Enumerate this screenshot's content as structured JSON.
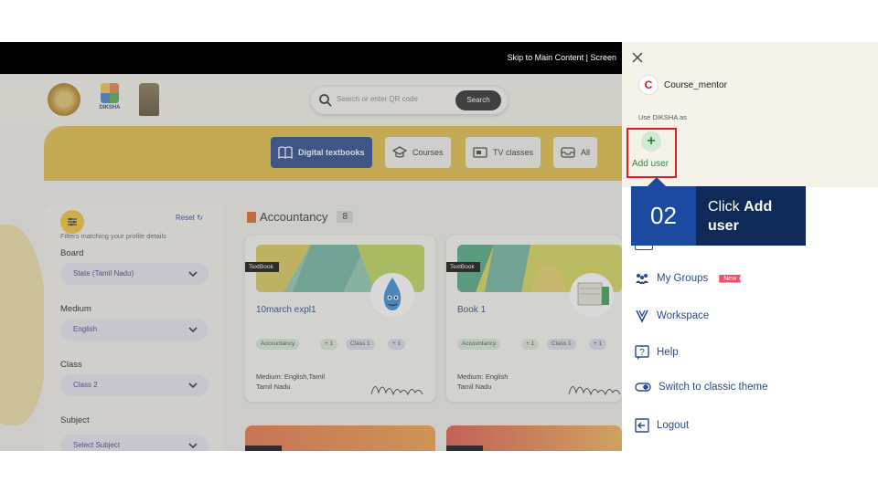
{
  "skip_bar": {
    "text": "Skip to Main Content  |  Screen"
  },
  "header": {
    "diksha_logo_text": "DIKSHA",
    "search_placeholder": "Search or enter QR code",
    "search_button": "Search"
  },
  "tabs": [
    {
      "label": "Digital textbooks",
      "icon": "book-icon",
      "active": true
    },
    {
      "label": "Courses",
      "icon": "graduation-cap-icon",
      "active": false
    },
    {
      "label": "TV classes",
      "icon": "tv-icon",
      "active": false
    },
    {
      "label": "All",
      "icon": "inbox-icon",
      "active": false
    }
  ],
  "filters": {
    "reset": "Reset",
    "note": "Filters matching your profile details",
    "board_label": "Board",
    "board_value": "State (Tamil Nadu)",
    "medium_label": "Medium",
    "medium_value": "English",
    "class_label": "Class",
    "class_value": "Class 2",
    "subject_label": "Subject",
    "subject_value": "Select Subject"
  },
  "section": {
    "title": "Accountancy",
    "count": "8"
  },
  "cards": [
    {
      "tag": "TextBook",
      "title": "10march expl1",
      "chips": [
        "Accountancy",
        "+ 1",
        "Class 1",
        "+ 1"
      ],
      "meta1": "Medium: English,Tamil",
      "meta2": "Tamil Nadu"
    },
    {
      "tag": "TextBook",
      "title": "Book 1",
      "chips": [
        "Accountancy",
        "+ 1",
        "Class 1",
        "+ 1"
      ],
      "meta1": "Medium: English",
      "meta2": "Tamil Nadu"
    }
  ],
  "panel": {
    "avatar_letter": "C",
    "username": "Course_mentor",
    "use_as": "Use DIKSHA as",
    "add_user": "Add user",
    "menu": [
      {
        "label": "My Groups",
        "icon": "groups-icon",
        "badge": "New"
      },
      {
        "label": "Workspace",
        "icon": "workspace-icon"
      },
      {
        "label": "Help",
        "icon": "help-icon"
      },
      {
        "label": "Switch to classic theme",
        "icon": "toggle-icon"
      },
      {
        "label": "Logout",
        "icon": "logout-icon"
      }
    ]
  },
  "callout": {
    "step": "02",
    "text_plain": "Click ",
    "text_bold": "Add user"
  },
  "colors": {
    "primary_blue": "#2a4a8a",
    "accent_yellow": "#e4be4a",
    "callout_dark": "#0f2a56",
    "callout_num": "#1b4aa0",
    "highlight_red": "#e02020",
    "add_green": "#2a8a3a"
  }
}
